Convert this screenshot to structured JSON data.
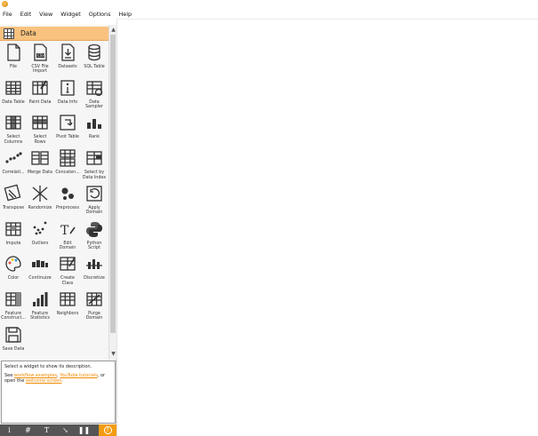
{
  "menubar": {
    "items": [
      "File",
      "Edit",
      "View",
      "Widget",
      "Options",
      "Help"
    ]
  },
  "toolbox": {
    "category": "Data",
    "widgets": [
      {
        "label": "File",
        "icon": "file-icon"
      },
      {
        "label": "CSV File\nImport",
        "icon": "csv-file-icon"
      },
      {
        "label": "Datasets",
        "icon": "datasets-icon"
      },
      {
        "label": "SQL Table",
        "icon": "database-icon"
      },
      {
        "label": "Data Table",
        "icon": "table-icon"
      },
      {
        "label": "Paint Data",
        "icon": "paint-data-icon"
      },
      {
        "label": "Data Info",
        "icon": "info-icon"
      },
      {
        "label": "Data\nSampler",
        "icon": "sampler-icon"
      },
      {
        "label": "Select\nColumns",
        "icon": "select-columns-icon"
      },
      {
        "label": "Select\nRows",
        "icon": "select-rows-icon"
      },
      {
        "label": "Pivot Table",
        "icon": "pivot-table-icon"
      },
      {
        "label": "Rank",
        "icon": "rank-icon"
      },
      {
        "label": "Correlati...",
        "icon": "correlations-icon"
      },
      {
        "label": "Merge Data",
        "icon": "merge-data-icon"
      },
      {
        "label": "Concaten...",
        "icon": "concatenate-icon"
      },
      {
        "label": "Select by\nData Index",
        "icon": "select-by-index-icon"
      },
      {
        "label": "Transpose",
        "icon": "transpose-icon"
      },
      {
        "label": "Randomize",
        "icon": "randomize-icon"
      },
      {
        "label": "Preprocess",
        "icon": "preprocess-icon"
      },
      {
        "label": "Apply\nDomain",
        "icon": "apply-domain-icon"
      },
      {
        "label": "Impute",
        "icon": "impute-icon"
      },
      {
        "label": "Outliers",
        "icon": "outliers-icon"
      },
      {
        "label": "Edit\nDomain",
        "icon": "edit-domain-icon"
      },
      {
        "label": "Python\nScript",
        "icon": "python-icon"
      },
      {
        "label": "Color",
        "icon": "palette-icon"
      },
      {
        "label": "Continuize",
        "icon": "continuize-icon"
      },
      {
        "label": "Create\nClass",
        "icon": "create-class-icon"
      },
      {
        "label": "Discretize",
        "icon": "discretize-icon"
      },
      {
        "label": "Feature\nConstruct...",
        "icon": "feature-constructor-icon"
      },
      {
        "label": "Feature\nStatistics",
        "icon": "feature-statistics-icon"
      },
      {
        "label": "Neighbors",
        "icon": "neighbors-icon"
      },
      {
        "label": "Purge\nDomain",
        "icon": "purge-domain-icon"
      },
      {
        "label": "Save Data",
        "icon": "save-icon"
      }
    ]
  },
  "description": {
    "text": "Select a widget to show its description.",
    "see": "See ",
    "link1": "workflow examples",
    "sep1": ", ",
    "link2": "YouTube tutorials",
    "sep2": ", or open the ",
    "link3": "welcome screen",
    "end": "."
  },
  "dock_toolbar": {
    "buttons": [
      {
        "glyph": "i",
        "icon": "info-icon"
      },
      {
        "glyph": "#",
        "icon": "grid-icon"
      },
      {
        "glyph": "T",
        "icon": "text-icon"
      },
      {
        "glyph": "↘",
        "icon": "arrow-icon"
      },
      {
        "glyph": "❚❚",
        "icon": "pause-icon"
      },
      {
        "glyph": "?",
        "icon": "help-icon"
      }
    ]
  },
  "colors": {
    "accent": "#f9c27f",
    "link": "#f08a00",
    "help": "#f39c12",
    "toolbar": "#555555"
  }
}
